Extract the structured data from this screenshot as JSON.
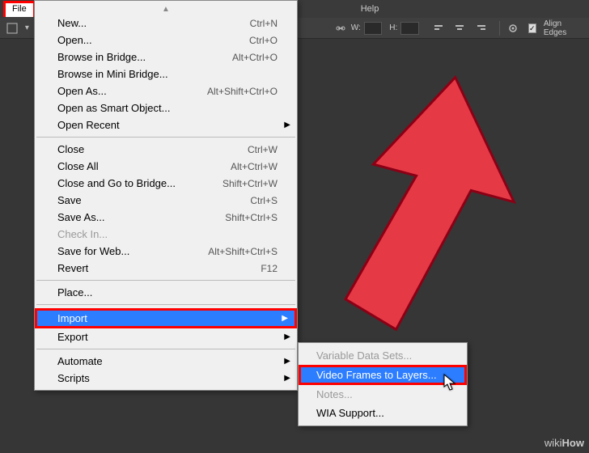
{
  "menubar": {
    "file": "File",
    "help": "Help"
  },
  "optbar": {
    "w": "W:",
    "h": "H:",
    "alignEdges": "Align Edges"
  },
  "menu": {
    "new": "New...",
    "new_sc": "Ctrl+N",
    "open": "Open...",
    "open_sc": "Ctrl+O",
    "browseBridge": "Browse in Bridge...",
    "browseBridge_sc": "Alt+Ctrl+O",
    "browseMiniBridge": "Browse in Mini Bridge...",
    "openAs": "Open As...",
    "openAs_sc": "Alt+Shift+Ctrl+O",
    "openSmart": "Open as Smart Object...",
    "openRecent": "Open Recent",
    "close": "Close",
    "close_sc": "Ctrl+W",
    "closeAll": "Close All",
    "closeAll_sc": "Alt+Ctrl+W",
    "closeBridge": "Close and Go to Bridge...",
    "closeBridge_sc": "Shift+Ctrl+W",
    "save": "Save",
    "save_sc": "Ctrl+S",
    "saveAs": "Save As...",
    "saveAs_sc": "Shift+Ctrl+S",
    "checkIn": "Check In...",
    "saveWeb": "Save for Web...",
    "saveWeb_sc": "Alt+Shift+Ctrl+S",
    "revert": "Revert",
    "revert_sc": "F12",
    "place": "Place...",
    "import": "Import",
    "export": "Export",
    "automate": "Automate",
    "scripts": "Scripts"
  },
  "submenu": {
    "varDataSets": "Variable Data Sets...",
    "videoFrames": "Video Frames to Layers...",
    "notes": "Notes...",
    "wia": "WIA Support..."
  },
  "watermark": {
    "wiki": "wiki",
    "how": "How"
  }
}
